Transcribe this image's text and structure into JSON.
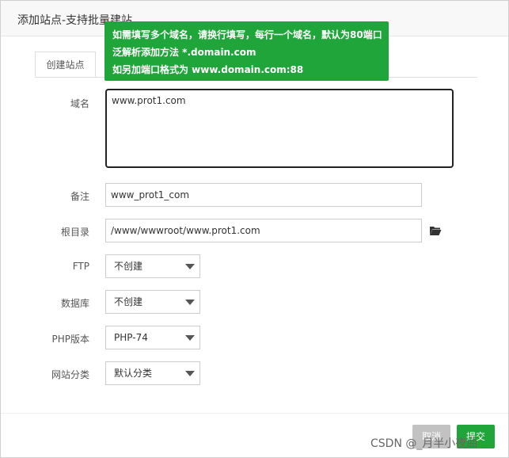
{
  "dialog": {
    "title": "添加站点-支持批量建站"
  },
  "tooltip": {
    "lines": [
      "如需填写多个域名，请换行填写，每行一个域名，默认为80端口",
      "泛解析添加方法 *.domain.com",
      "如另加端口格式为 www.domain.com:88"
    ]
  },
  "tabs": [
    {
      "label": "创建站点",
      "active": true
    }
  ],
  "form": {
    "domain": {
      "label": "域名",
      "value": "www.prot1.com"
    },
    "remark": {
      "label": "备注",
      "value": "www_prot1_com"
    },
    "root": {
      "label": "根目录",
      "value": "/www/wwwroot/www.prot1.com",
      "icon": "folder-open-icon"
    },
    "ftp": {
      "label": "FTP",
      "value": "不创建"
    },
    "database": {
      "label": "数据库",
      "value": "不创建"
    },
    "php": {
      "label": "PHP版本",
      "value": "PHP-74"
    },
    "category": {
      "label": "网站分类",
      "value": "默认分类"
    }
  },
  "buttons": {
    "cancel": "取消",
    "submit": "提交"
  },
  "watermark": "CSDN @_月半小夜曲",
  "colors": {
    "accent": "#20a53a",
    "cancel": "#c2c2c2"
  }
}
